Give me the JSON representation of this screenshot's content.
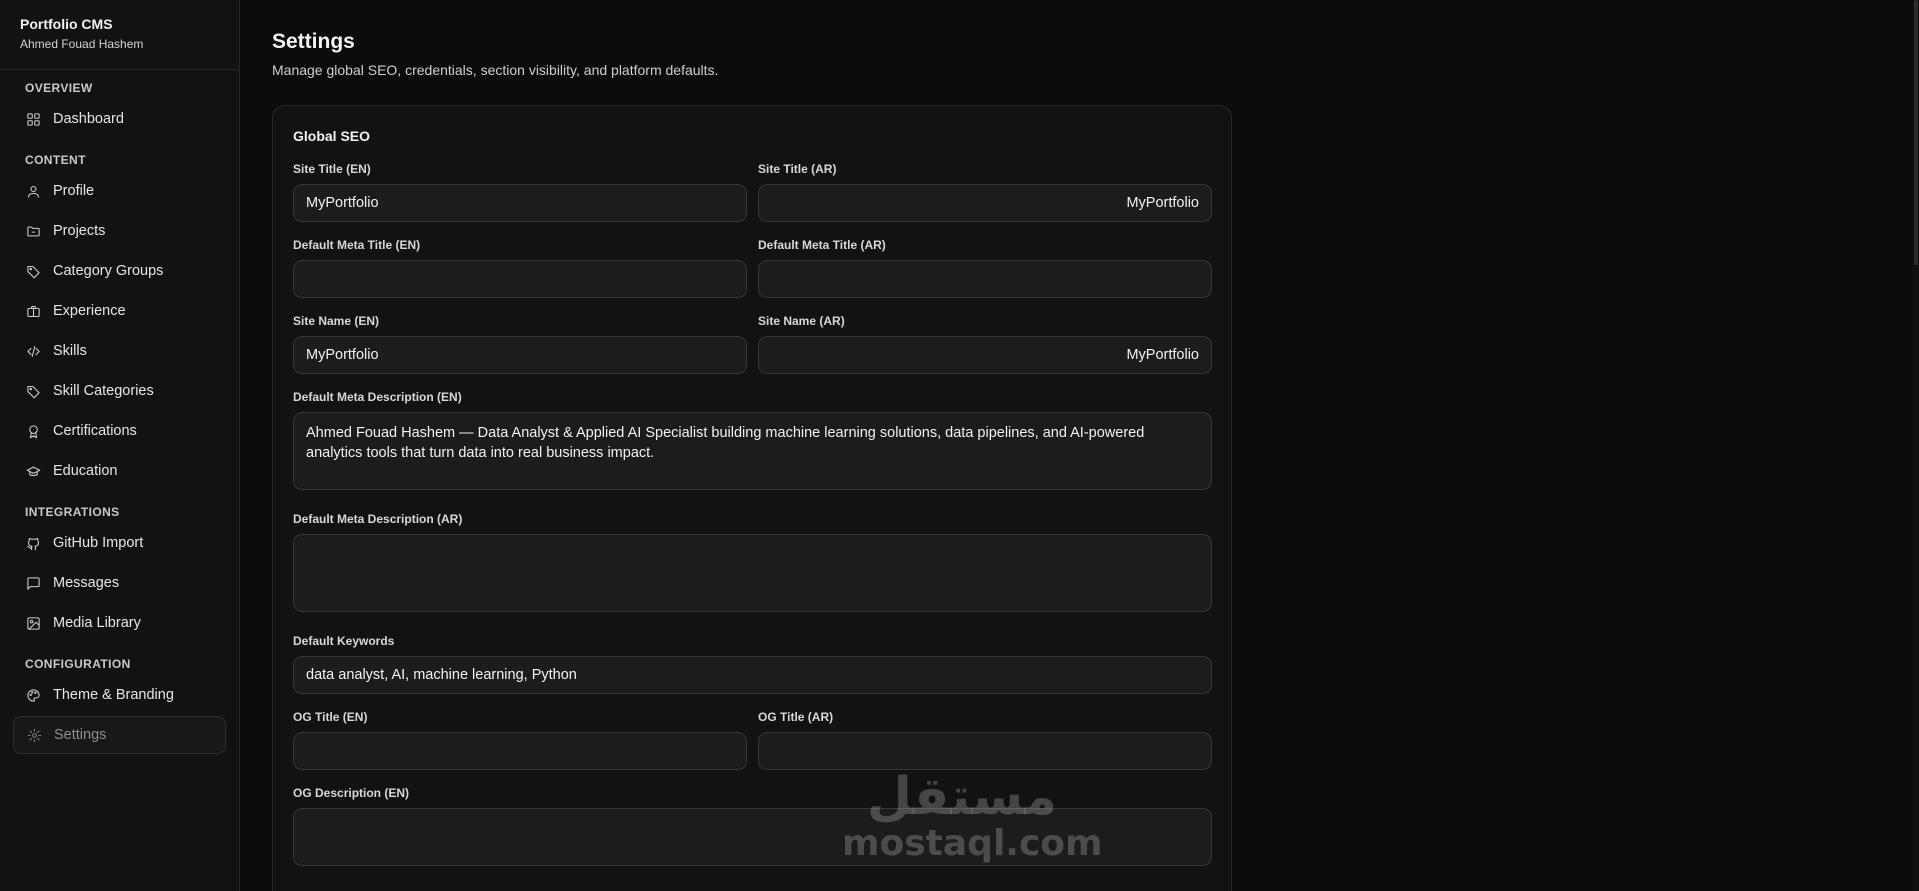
{
  "app": {
    "name": "Portfolio CMS",
    "user": "Ahmed Fouad Hashem"
  },
  "sidebar": {
    "sections": [
      {
        "label": "OVERVIEW",
        "items": [
          {
            "label": "Dashboard",
            "icon": "dashboard-icon"
          }
        ]
      },
      {
        "label": "CONTENT",
        "items": [
          {
            "label": "Profile",
            "icon": "user-icon"
          },
          {
            "label": "Projects",
            "icon": "folder-icon"
          },
          {
            "label": "Category Groups",
            "icon": "tag-icon"
          },
          {
            "label": "Experience",
            "icon": "briefcase-icon"
          },
          {
            "label": "Skills",
            "icon": "code-icon"
          },
          {
            "label": "Skill Categories",
            "icon": "tag-icon"
          },
          {
            "label": "Certifications",
            "icon": "award-icon"
          },
          {
            "label": "Education",
            "icon": "graduation-cap-icon"
          }
        ]
      },
      {
        "label": "INTEGRATIONS",
        "items": [
          {
            "label": "GitHub Import",
            "icon": "github-icon"
          },
          {
            "label": "Messages",
            "icon": "message-icon"
          },
          {
            "label": "Media Library",
            "icon": "image-icon"
          }
        ]
      },
      {
        "label": "CONFIGURATION",
        "items": [
          {
            "label": "Theme & Branding",
            "icon": "palette-icon"
          },
          {
            "label": "Settings",
            "icon": "gear-icon",
            "active": true
          }
        ]
      }
    ]
  },
  "page": {
    "title": "Settings",
    "subtitle": "Manage global SEO, credentials, section visibility, and platform defaults."
  },
  "seo": {
    "title": "Global SEO",
    "site_title_en": {
      "label": "Site Title (EN)",
      "value": "MyPortfolio"
    },
    "site_title_ar": {
      "label": "Site Title (AR)",
      "value": "MyPortfolio"
    },
    "meta_title_en": {
      "label": "Default Meta Title (EN)",
      "value": ""
    },
    "meta_title_ar": {
      "label": "Default Meta Title (AR)",
      "value": ""
    },
    "site_name_en": {
      "label": "Site Name (EN)",
      "value": "MyPortfolio"
    },
    "site_name_ar": {
      "label": "Site Name (AR)",
      "value": "MyPortfolio"
    },
    "meta_desc_en": {
      "label": "Default Meta Description (EN)",
      "value": "Ahmed Fouad Hashem — Data Analyst & Applied AI Specialist building machine learning solutions, data pipelines, and AI-powered analytics tools that turn data into real business impact."
    },
    "meta_desc_ar": {
      "label": "Default Meta Description (AR)",
      "value": ""
    },
    "keywords": {
      "label": "Default Keywords",
      "value": "data analyst, AI, machine learning, Python"
    },
    "og_title_en": {
      "label": "OG Title (EN)",
      "value": ""
    },
    "og_title_ar": {
      "label": "OG Title (AR)",
      "value": ""
    },
    "og_desc_en": {
      "label": "OG Description (EN)",
      "value": ""
    }
  },
  "watermark": {
    "arabic": "مستقل",
    "latin": "mostaql.com"
  }
}
